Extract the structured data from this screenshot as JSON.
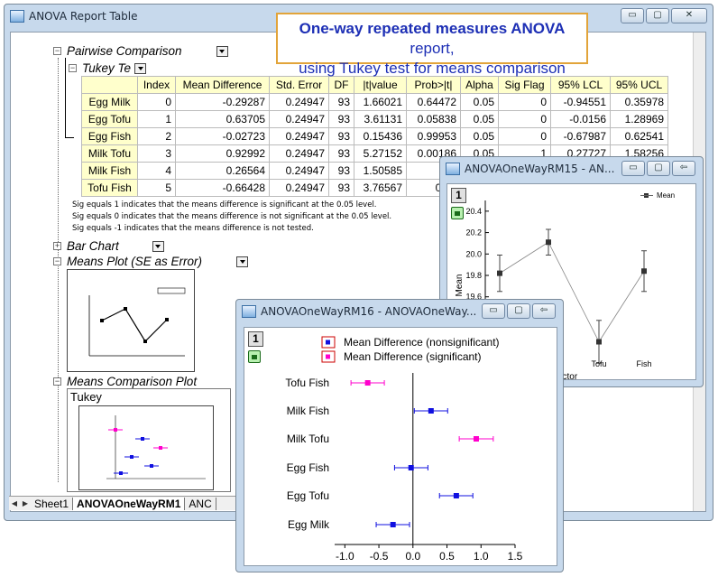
{
  "main_window": {
    "title": "ANOVA Report Table",
    "minimize": "▭",
    "maximize": "▢",
    "close": "✕"
  },
  "sections": {
    "pairwise": "Pairwise Comparison",
    "tukey": "Tukey Te",
    "bar_chart": "Bar Chart",
    "means_plot": "Means Plot (SE as Error)",
    "means_comparison": "Means Comparison Plot",
    "mc_sub": "Tukey"
  },
  "table": {
    "headers": [
      "",
      "Index",
      "Mean Difference",
      "Std. Error",
      "DF",
      "|t|value",
      "Prob>|t|",
      "Alpha",
      "Sig Flag",
      "95% LCL",
      "95% UCL"
    ],
    "rows": [
      [
        "Egg Milk",
        "0",
        "-0.29287",
        "0.24947",
        "93",
        "1.66021",
        "0.64472",
        "0.05",
        "0",
        "-0.94551",
        "0.35978"
      ],
      [
        "Egg Tofu",
        "1",
        "0.63705",
        "0.24947",
        "93",
        "3.61131",
        "0.05838",
        "0.05",
        "0",
        "-0.0156",
        "1.28969"
      ],
      [
        "Egg Fish",
        "2",
        "-0.02723",
        "0.24947",
        "93",
        "0.15436",
        "0.99953",
        "0.05",
        "0",
        "-0.67987",
        "0.62541"
      ],
      [
        "Milk Tofu",
        "3",
        "0.92992",
        "0.24947",
        "93",
        "5.27152",
        "0.00186",
        "0.05",
        "1",
        "0.27727",
        "1.58256"
      ],
      [
        "Milk Fish",
        "4",
        "0.26564",
        "0.24947",
        "93",
        "1.50585",
        "0.7",
        "",
        "",
        "",
        ""
      ],
      [
        "Tofu Fish",
        "5",
        "-0.66428",
        "0.24947",
        "93",
        "3.76567",
        "0.04",
        "",
        "",
        "",
        ""
      ]
    ]
  },
  "notes": [
    "Sig equals 1 indicates that the means difference is significant at the 0.05 level.",
    "Sig equals 0 indicates that the means difference is not significant at the 0.05 level.",
    "Sig equals -1 indicates that the means difference is not tested."
  ],
  "sheet_tabs": [
    "Sheet1",
    "ANOVAOneWayRM1",
    "ANC"
  ],
  "callout": {
    "bold": "One-way repeated measures ANOVA",
    "rest1": " report,",
    "line2": "using Tukey test for means comparison"
  },
  "graph15": {
    "title": "ANOVAOneWayRM15 - AN...",
    "page_number": "1",
    "ylabel": "Mean",
    "xlabel": "Factor",
    "legend": "Mean",
    "yticks": [
      "20.4",
      "20.2",
      "20.0",
      "19.8",
      "19.6",
      "19.4"
    ],
    "xticks": [
      "Tofu",
      "Fish"
    ]
  },
  "graph16": {
    "title": "ANOVAOneWayRM16 - ANOVAOneWay...",
    "page_number": "1",
    "legend_ns": "Mean Difference (nonsignificant)",
    "legend_s": "Mean Difference (significant)",
    "colors": {
      "nonsig": "#1010e0",
      "sig": "#ff00cc"
    }
  },
  "chart_data": [
    {
      "type": "line",
      "categories": [
        "Egg",
        "Milk",
        "Tofu",
        "Fish"
      ],
      "series": [
        {
          "name": "Mean",
          "values": [
            19.82,
            20.11,
            19.18,
            19.84
          ],
          "errors": [
            0.17,
            0.12,
            0.2,
            0.19
          ]
        }
      ],
      "xlabel": "Factor",
      "ylabel": "Mean",
      "ylim": [
        19.1,
        20.5
      ],
      "legend": "top-right"
    },
    {
      "type": "scatter",
      "categories": [
        "Egg Milk",
        "Egg Tofu",
        "Egg Fish",
        "Milk Tofu",
        "Milk Fish",
        "Tofu Fish"
      ],
      "values": [
        -0.29287,
        0.63705,
        -0.02723,
        0.92992,
        0.26564,
        -0.66428
      ],
      "lcl": [
        -0.54,
        0.39,
        -0.27,
        0.68,
        0.02,
        -0.91
      ],
      "ucl": [
        -0.05,
        0.88,
        0.22,
        1.18,
        0.51,
        -0.42
      ],
      "significant": [
        0,
        0,
        0,
        1,
        0,
        1
      ],
      "xticks": [
        "-1.0",
        "-0.5",
        "0.0",
        "0.5",
        "1.0",
        "1.5"
      ],
      "xlim": [
        -1.15,
        1.5
      ]
    }
  ]
}
